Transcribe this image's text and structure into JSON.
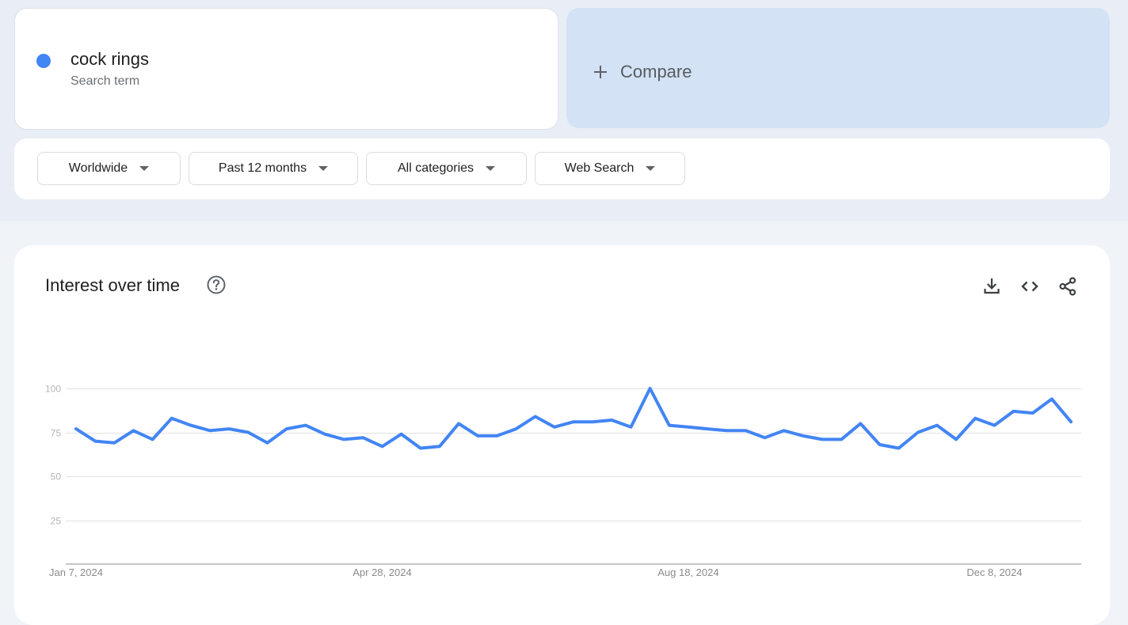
{
  "search_term": {
    "label": "cock rings",
    "type": "Search term",
    "color": "#4285f4"
  },
  "compare": {
    "icon": "plus-icon",
    "label": "Compare"
  },
  "filters": [
    {
      "label": "Worldwide",
      "icon": "caret-down-icon"
    },
    {
      "label": "Past 12 months",
      "icon": "caret-down-icon"
    },
    {
      "label": "All categories",
      "icon": "caret-down-icon"
    },
    {
      "label": "Web Search",
      "icon": "caret-down-icon"
    }
  ],
  "interest_card": {
    "title": "Interest over time",
    "help_icon": "help-circle-icon",
    "actions": [
      {
        "name": "download",
        "icon": "download-icon"
      },
      {
        "name": "embed",
        "icon": "code-icon"
      },
      {
        "name": "share",
        "icon": "share-icon"
      }
    ]
  },
  "chart_data": {
    "type": "line",
    "title": "Interest over time",
    "xlabel": "",
    "ylabel": "",
    "ylim": [
      0,
      100
    ],
    "yticks": [
      25,
      50,
      75,
      100
    ],
    "ytick_labels": [
      "25",
      "50",
      "75",
      "100"
    ],
    "xtick_labels": [
      "Jan 7, 2024",
      "Apr 28, 2024",
      "Aug 18, 2024",
      "Dec 8, 2024"
    ],
    "xtick_index": [
      0,
      16,
      32,
      48
    ],
    "grid": true,
    "legend": "none",
    "x": [
      "Jan 7, 2024",
      "Jan 14, 2024",
      "Jan 21, 2024",
      "Jan 28, 2024",
      "Feb 4, 2024",
      "Feb 11, 2024",
      "Feb 18, 2024",
      "Feb 25, 2024",
      "Mar 3, 2024",
      "Mar 10, 2024",
      "Mar 17, 2024",
      "Mar 24, 2024",
      "Mar 31, 2024",
      "Apr 7, 2024",
      "Apr 14, 2024",
      "Apr 21, 2024",
      "Apr 28, 2024",
      "May 5, 2024",
      "May 12, 2024",
      "May 19, 2024",
      "May 26, 2024",
      "Jun 2, 2024",
      "Jun 9, 2024",
      "Jun 16, 2024",
      "Jun 23, 2024",
      "Jun 30, 2024",
      "Jul 7, 2024",
      "Jul 14, 2024",
      "Jul 21, 2024",
      "Jul 28, 2024",
      "Aug 4, 2024",
      "Aug 11, 2024",
      "Aug 18, 2024",
      "Aug 25, 2024",
      "Sep 1, 2024",
      "Sep 8, 2024",
      "Sep 15, 2024",
      "Sep 22, 2024",
      "Sep 29, 2024",
      "Oct 6, 2024",
      "Oct 13, 2024",
      "Oct 20, 2024",
      "Oct 27, 2024",
      "Nov 3, 2024",
      "Nov 10, 2024",
      "Nov 17, 2024",
      "Nov 24, 2024",
      "Dec 1, 2024",
      "Dec 8, 2024",
      "Dec 15, 2024",
      "Dec 22, 2024",
      "Dec 29, 2024",
      "Jan 5, 2025"
    ],
    "series": [
      {
        "name": "cock rings",
        "color": "#4285f4",
        "values": [
          77,
          70,
          69,
          76,
          71,
          83,
          79,
          76,
          77,
          75,
          69,
          77,
          79,
          74,
          71,
          72,
          67,
          74,
          66,
          67,
          80,
          73,
          73,
          77,
          84,
          78,
          81,
          81,
          82,
          78,
          100,
          79,
          78,
          77,
          76,
          76,
          72,
          76,
          73,
          71,
          71,
          80,
          68,
          66,
          75,
          79,
          71,
          83,
          79,
          87,
          86,
          94,
          81
        ]
      }
    ]
  }
}
